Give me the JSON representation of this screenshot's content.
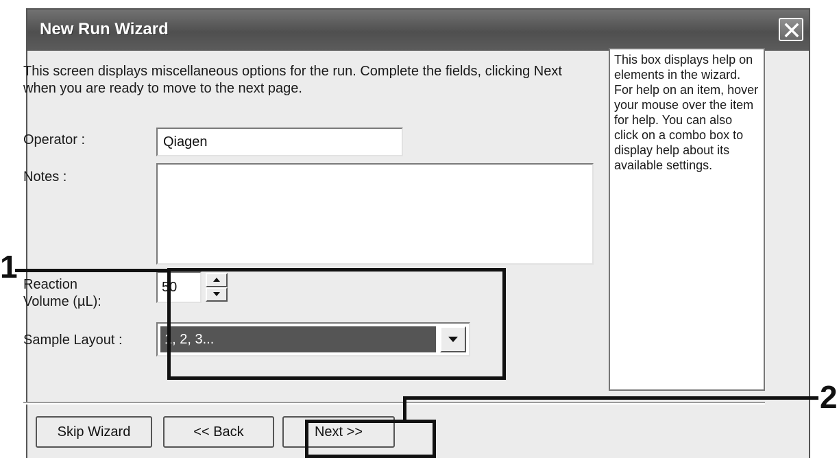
{
  "window": {
    "title": "New Run Wizard"
  },
  "intro": "This screen displays miscellaneous options for the run. Complete the fields, clicking Next when you are ready to move to the next page.",
  "form": {
    "operator_label": "Operator :",
    "operator_value": "Qiagen",
    "notes_label": "Notes :",
    "notes_value": "",
    "volume_label_line1": "Reaction",
    "volume_label_line2": "Volume (µL):",
    "volume_value": "50",
    "layout_label": "Sample Layout :",
    "layout_value": "1, 2, 3..."
  },
  "help": "This box displays help on elements in the wizard. For help on an item, hover your mouse over the item for help. You can also click on a combo box to display help about its available settings.",
  "buttons": {
    "skip": "Skip Wizard",
    "back": "<< Back",
    "next": "Next >>"
  },
  "callouts": {
    "one": "1",
    "two": "2"
  }
}
